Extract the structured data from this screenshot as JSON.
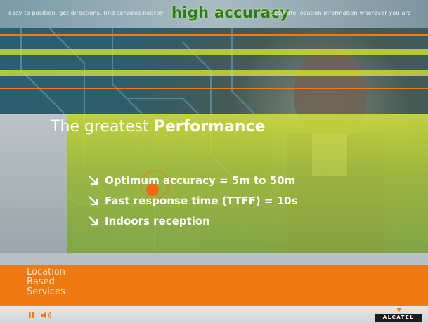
{
  "header": {
    "headline": "high accuracy",
    "tagline_left": "easy to position, get directions, find services nearby",
    "tagline_right": "accurate location information wherever you are"
  },
  "panel": {
    "title_prefix": "The greatest",
    "title_emphasis": "Performance",
    "bullets": [
      "Optimum accuracy = 5m to 50m",
      "Fast response time (TTFF) = 10s",
      "Indoors reception"
    ]
  },
  "section": {
    "lines": [
      "Location",
      "Based",
      "Services"
    ]
  },
  "footer": {
    "logo": "ALCATEL"
  },
  "colors": {
    "orange": "#f07a12",
    "lime": "#d6e630",
    "headline_green": "#2b7a1f"
  }
}
